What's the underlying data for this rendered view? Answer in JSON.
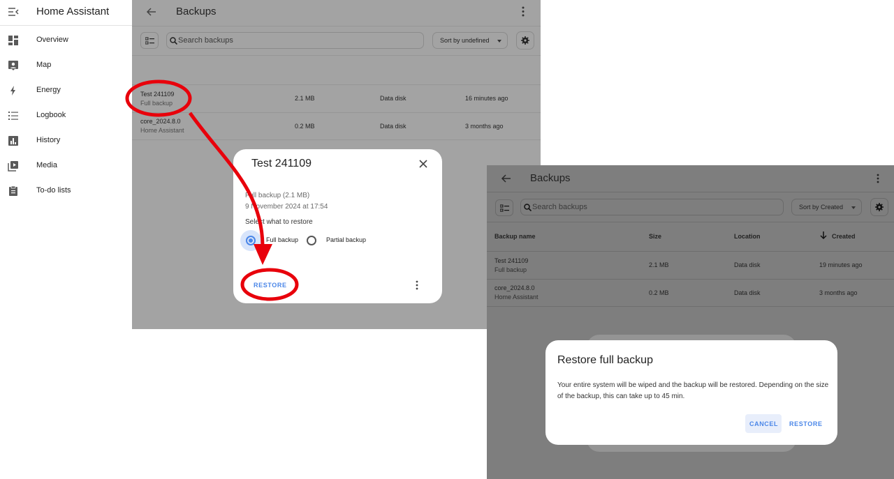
{
  "sidebar": {
    "app_title": "Home Assistant",
    "items": [
      {
        "label": "Overview",
        "icon": "dashboard-icon"
      },
      {
        "label": "Map",
        "icon": "map-icon"
      },
      {
        "label": "Energy",
        "icon": "lightning-icon"
      },
      {
        "label": "Logbook",
        "icon": "list-icon"
      },
      {
        "label": "History",
        "icon": "chart-icon"
      },
      {
        "label": "Media",
        "icon": "media-icon"
      },
      {
        "label": "To-do lists",
        "icon": "clipboard-icon"
      }
    ]
  },
  "left_panel": {
    "title": "Backups",
    "search_placeholder": "Search backups",
    "sort_label": "Sort by undefined",
    "rows": [
      {
        "name": "Test 241109",
        "type": "Full backup",
        "size": "2.1 MB",
        "location": "Data disk",
        "created": "16 minutes ago"
      },
      {
        "name": "core_2024.8.0",
        "type": "Home Assistant",
        "size": "0.2 MB",
        "location": "Data disk",
        "created": "3 months ago"
      }
    ]
  },
  "restore_dialog": {
    "title": "Test 241109",
    "summary": "Full backup (2.1 MB)",
    "date": "9 November 2024 at 17:54",
    "prompt": "Select what to restore",
    "option_full": "Full backup",
    "option_partial": "Partial backup",
    "restore_label": "RESTORE"
  },
  "right_panel": {
    "title": "Backups",
    "search_placeholder": "Search backups",
    "sort_label": "Sort by Created",
    "columns": [
      "Backup name",
      "Size",
      "Location",
      "Created"
    ],
    "rows": [
      {
        "name": "Test 241109",
        "type": "Full backup",
        "size": "2.1 MB",
        "location": "Data disk",
        "created": "19 minutes ago"
      },
      {
        "name": "core_2024.8.0",
        "type": "Home Assistant",
        "size": "0.2 MB",
        "location": "Data disk",
        "created": "3 months ago"
      }
    ]
  },
  "confirm_dialog": {
    "title": "Restore full backup",
    "body": "Your entire system will be wiped and the backup will be restored. Depending on the size of the backup, this can take up to 45 min.",
    "cancel_label": "CANCEL",
    "restore_label": "RESTORE"
  },
  "colors": {
    "accent": "#4a86e8",
    "annotation": "#e8000b",
    "overlay_left": "#a3a3a3",
    "overlay_right": "#7e7e7e"
  }
}
